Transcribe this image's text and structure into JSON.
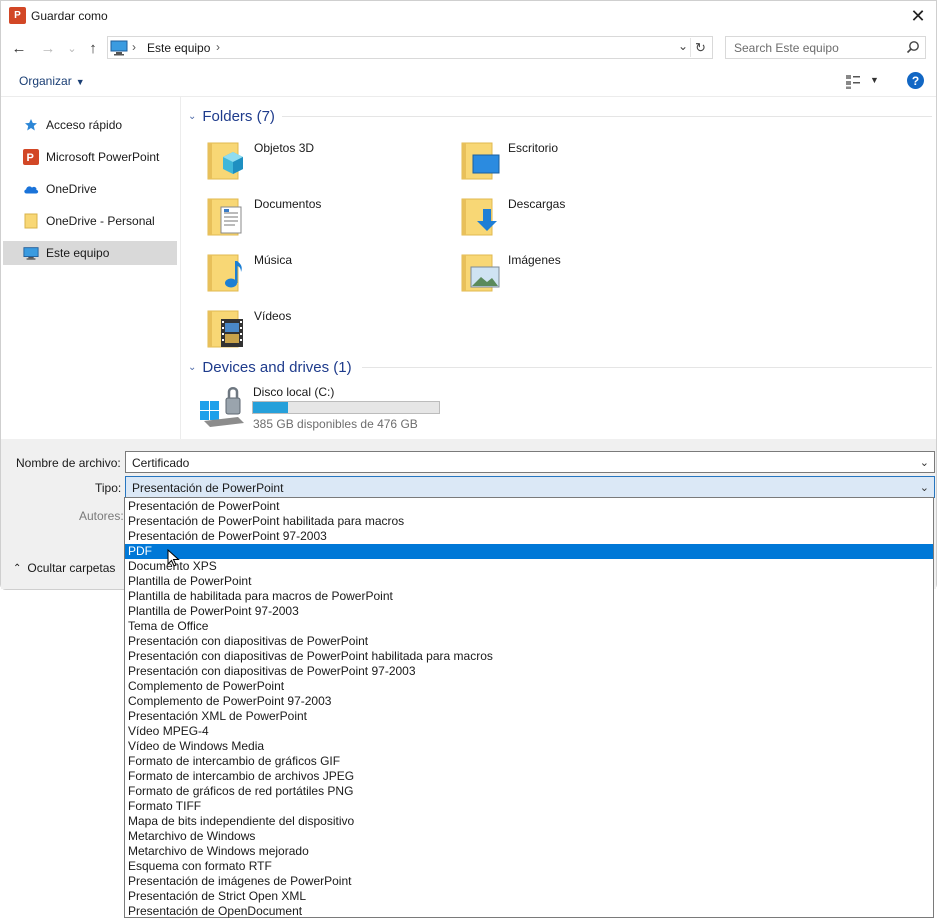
{
  "window": {
    "title": "Guardar como",
    "app_icon": "powerpoint-icon",
    "close_glyph": "✕"
  },
  "nav": {
    "back_glyph": "←",
    "forward_glyph": "→",
    "recent_glyph": "⌄",
    "up_glyph": "↑",
    "address_sep": "›",
    "address": "Este equipo",
    "address_dropdown_glyph": "⌄",
    "refresh_glyph": "↻",
    "search_placeholder": "Search Este equipo"
  },
  "toolbar": {
    "organize": "Organizar",
    "organize_caret": "▼",
    "view_caret": "▼",
    "help": "?"
  },
  "sidebar": {
    "items": [
      {
        "label": "Acceso rápido",
        "icon": "star-icon"
      },
      {
        "label": "Microsoft PowerPoint",
        "icon": "powerpoint-icon"
      },
      {
        "label": "OneDrive",
        "icon": "cloud-icon"
      },
      {
        "label": "OneDrive - Personal",
        "icon": "folder-icon"
      },
      {
        "label": "Este equipo",
        "icon": "computer-icon",
        "selected": true
      }
    ]
  },
  "folders": {
    "header": "Folders (7)",
    "chevron": "⌄",
    "items": [
      {
        "label": "Objetos 3D",
        "icon": "objects-3d-folder-icon"
      },
      {
        "label": "Escritorio",
        "icon": "desktop-folder-icon"
      },
      {
        "label": "Documentos",
        "icon": "documents-folder-icon"
      },
      {
        "label": "Descargas",
        "icon": "downloads-folder-icon"
      },
      {
        "label": "Música",
        "icon": "music-folder-icon"
      },
      {
        "label": "Imágenes",
        "icon": "pictures-folder-icon"
      },
      {
        "label": "Vídeos",
        "icon": "videos-folder-icon"
      }
    ]
  },
  "devices": {
    "header": "Devices and drives (1)",
    "chevron": "⌄",
    "drive": {
      "label": "Disco local (C:)",
      "free_text": "385 GB disponibles de 476 GB",
      "used_fraction": 0.19,
      "fill_color": "#26a0da"
    }
  },
  "form": {
    "filename_label": "Nombre de archivo:",
    "filename_value": "Certificado",
    "type_label": "Tipo:",
    "type_value": "Presentación de PowerPoint",
    "authors_label": "Autores:",
    "dropdown_glyph": "⌄",
    "hide_folders": "Ocultar carpetas",
    "hide_chevron": "⌃"
  },
  "type_options": [
    "Presentación de PowerPoint",
    "Presentación de PowerPoint habilitada para macros",
    "Presentación de PowerPoint 97-2003",
    "PDF",
    "Documento XPS",
    "Plantilla de PowerPoint",
    "Plantilla de habilitada para macros de PowerPoint",
    "Plantilla de PowerPoint 97-2003",
    "Tema de Office",
    "Presentación con diapositivas de PowerPoint",
    "Presentación con diapositivas de PowerPoint habilitada para macros",
    "Presentación con diapositivas de PowerPoint 97-2003",
    "Complemento de PowerPoint",
    "Complemento de PowerPoint 97-2003",
    "Presentación XML de PowerPoint",
    "Vídeo MPEG-4",
    "Vídeo de Windows Media",
    "Formato de intercambio de gráficos GIF",
    "Formato de intercambio de archivos JPEG",
    "Formato de gráficos de red portátiles PNG",
    "Formato TIFF",
    "Mapa de bits independiente del dispositivo",
    "Metarchivo de Windows",
    "Metarchivo de Windows mejorado",
    "Esquema con formato RTF",
    "Presentación de imágenes de PowerPoint",
    "Presentación de Strict Open XML",
    "Presentación de OpenDocument"
  ],
  "selected_type_index": 3,
  "colors": {
    "accent": "#0078d7",
    "link": "#1e3b8c",
    "powerpoint": "#d24726",
    "folder": "#f8d775"
  }
}
